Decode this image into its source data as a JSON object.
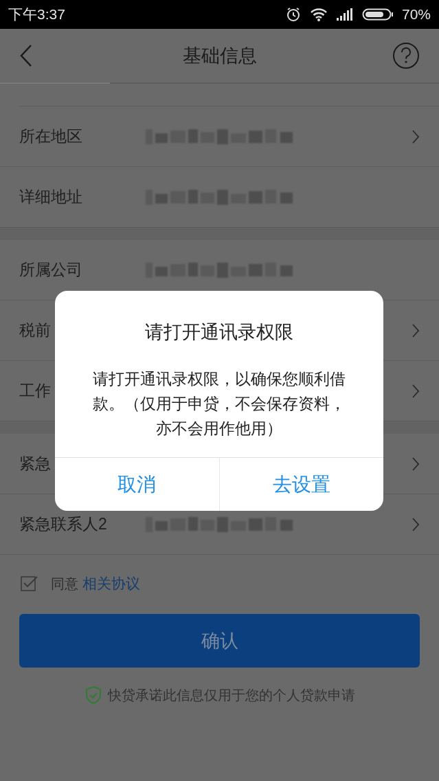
{
  "status_bar": {
    "time": "下午3:37",
    "battery": "70%"
  },
  "header": {
    "title": "基础信息"
  },
  "rows": [
    {
      "label": "所在地区",
      "value_hidden": true,
      "chevron": true,
      "section_start": false
    },
    {
      "label": "详细地址",
      "value_hidden": true,
      "chevron": false,
      "section_start": false
    },
    {
      "label": "所属公司",
      "value_hidden": true,
      "chevron": false,
      "section_start": true
    },
    {
      "label": "税前",
      "value_hidden": false,
      "chevron": true,
      "section_start": false
    },
    {
      "label": "工作",
      "value_hidden": false,
      "chevron": true,
      "section_start": false
    },
    {
      "label": "紧急",
      "value_hidden": false,
      "chevron": true,
      "section_start": true
    },
    {
      "label": "紧急联系人2",
      "value_hidden": true,
      "chevron": true,
      "section_start": false
    }
  ],
  "agreement": {
    "checked": true,
    "text": "同意",
    "link": "相关协议"
  },
  "confirm_button": "确认",
  "promise": "快贷承诺此信息仅用于您的个人贷款申请",
  "dialog": {
    "title": "请打开通讯录权限",
    "message": "请打开通讯录权限，以确保您顺利借款。（仅用于申贷，不会保存资料，亦不会用作他用）",
    "buttons": [
      "取消",
      "去设置"
    ]
  }
}
